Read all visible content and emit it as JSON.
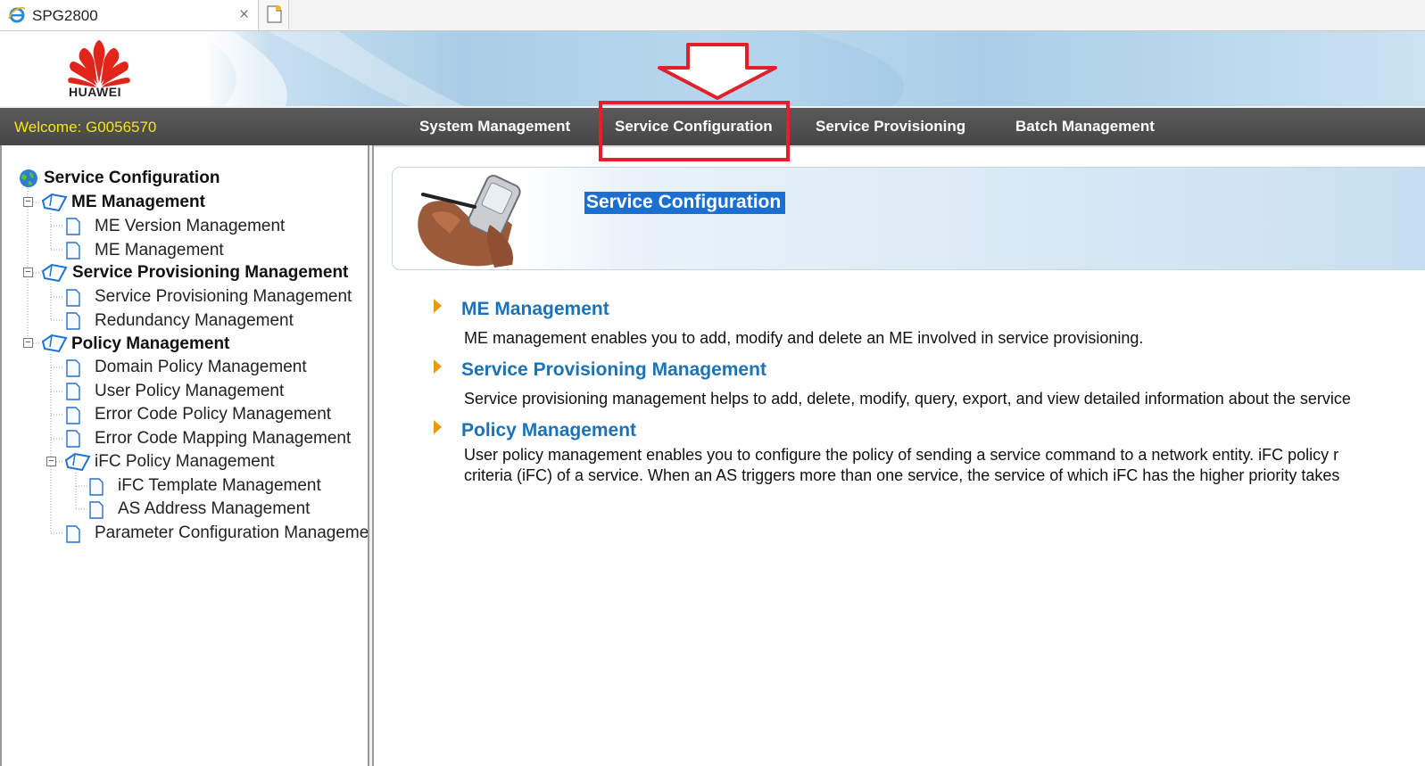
{
  "browser": {
    "tab_title": "SPG2800",
    "close_glyph": "×"
  },
  "branding": {
    "logo_text": "HUAWEI",
    "brand_color": "#e1251b"
  },
  "navbar": {
    "welcome_label": "Welcome:  G0056570",
    "items": [
      {
        "label": "System Management"
      },
      {
        "label": "Service Configuration"
      },
      {
        "label": "Service Provisioning"
      },
      {
        "label": "Batch Management"
      }
    ],
    "highlight_color": "#e0202a"
  },
  "tree": {
    "root": "Service Configuration",
    "groups": [
      {
        "label": "ME Management",
        "children": [
          "ME Version Management",
          "ME Management"
        ]
      },
      {
        "label": "Service Provisioning Management",
        "children": [
          "Service Provisioning Management",
          "Redundancy Management"
        ]
      },
      {
        "label": "Policy Management",
        "children": [
          "Domain Policy Management",
          "User Policy Management",
          "Error Code Policy Management",
          "Error Code Mapping Management"
        ],
        "subgroup": {
          "label": "iFC Policy Management",
          "children": [
            "iFC Template Management",
            "AS Address Management"
          ]
        },
        "trailing": [
          "Parameter Configuration Manageme"
        ]
      }
    ]
  },
  "main": {
    "title": "Service Configuration",
    "sections": [
      {
        "link": "ME Management",
        "desc": [
          "ME management enables you to add, modify and delete an ME involved in service provisioning."
        ]
      },
      {
        "link": "Service Provisioning Management",
        "desc": [
          "Service provisioning management helps to add, delete, modify, query, export, and view detailed information about the service"
        ]
      },
      {
        "link": "Policy Management",
        "desc": [
          "User policy management enables you to configure the policy of sending a service command to a network entity. iFC policy r",
          "criteria (iFC) of a service. When an AS triggers more than one service, the service of which iFC has the higher priority takes"
        ]
      }
    ]
  }
}
